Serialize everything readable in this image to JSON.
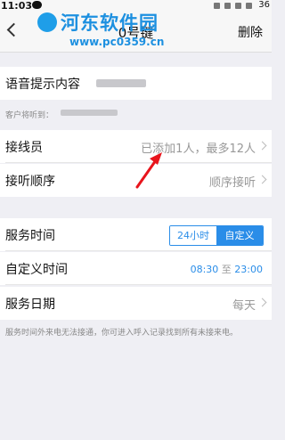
{
  "status_bar": {
    "time": "11:03",
    "right_text": "36"
  },
  "nav": {
    "title": "0号键",
    "delete_label": "删除"
  },
  "watermark": {
    "title": "河东软件园",
    "url": "www.pc0359.cn"
  },
  "voice_prompt": {
    "label": "语音提示内容"
  },
  "customer_hears": {
    "label": "客户将听到："
  },
  "operators": {
    "label": "接线员",
    "value": "已添加1人，最多12人"
  },
  "answer_order": {
    "label": "接听顺序",
    "value": "顺序接听"
  },
  "service_time": {
    "label": "服务时间",
    "option_24h": "24小时",
    "option_custom": "自定义",
    "selected": "自定义"
  },
  "custom_time": {
    "label": "自定义时间",
    "start": "08:30",
    "to": "至",
    "end": "23:00"
  },
  "service_date": {
    "label": "服务日期",
    "value": "每天"
  },
  "footer_note": "服务时间外来电无法接通，你可进入呼入记录找到所有未接来电。",
  "colors": {
    "accent": "#2a8de8",
    "annotation_arrow": "#e8141c"
  }
}
